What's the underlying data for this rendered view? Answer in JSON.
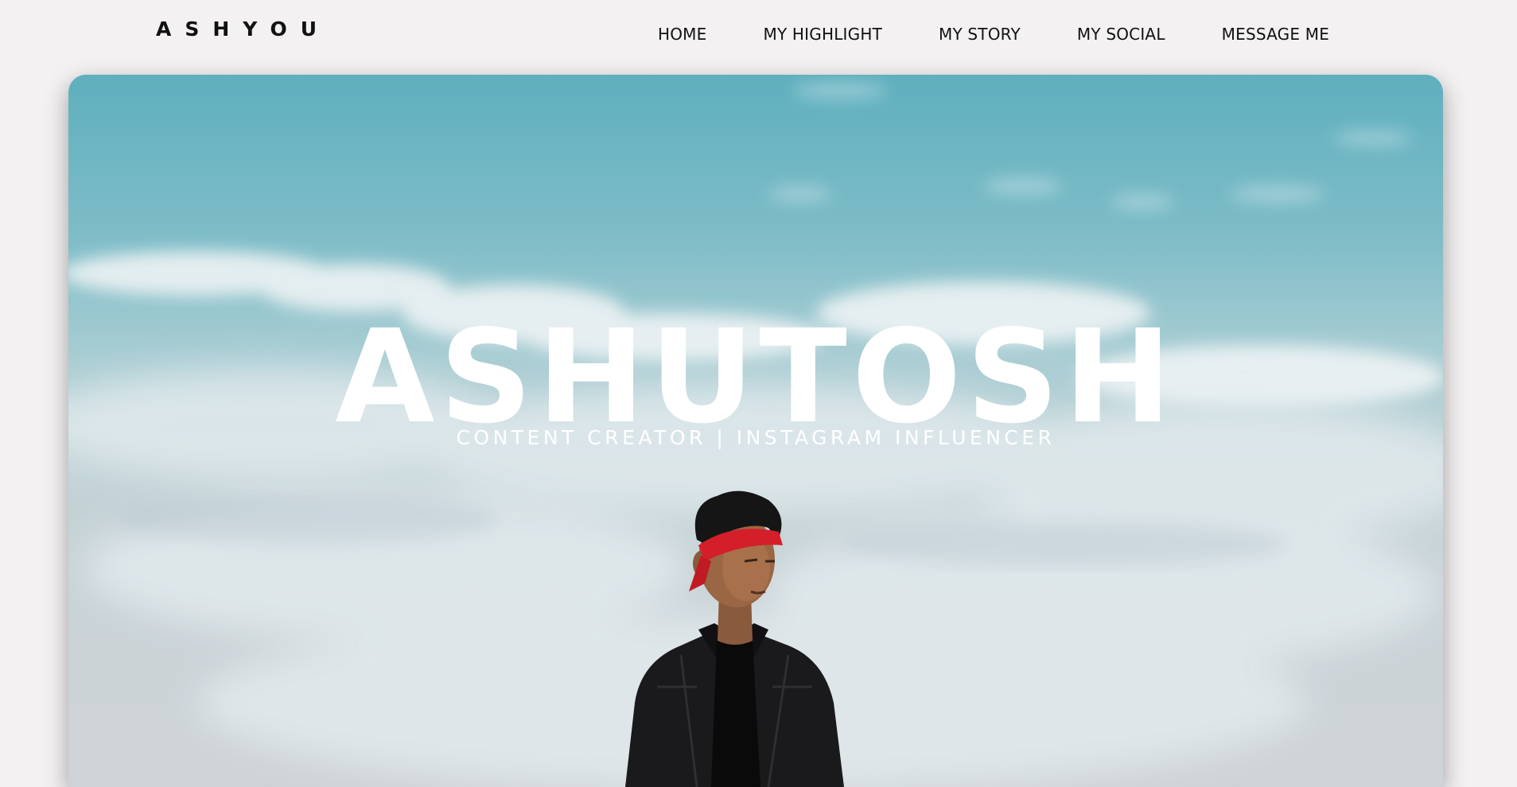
{
  "brand": {
    "logo": "ASHYOU"
  },
  "nav": {
    "items": [
      {
        "label": "HOME"
      },
      {
        "label": "MY HIGHLIGHT"
      },
      {
        "label": "MY STORY"
      },
      {
        "label": "MY SOCIAL"
      },
      {
        "label": "MESSAGE ME"
      }
    ]
  },
  "hero": {
    "title": "ASHUTOSH",
    "subtitle": "CONTENT CREATOR | INSTAGRAM INFLUENCER"
  },
  "colors": {
    "page_bg": "#f3f1f1",
    "sky_top": "#5fafbe",
    "sky_bottom": "#cfd3d7",
    "headband": "#d41f2b",
    "text_light": "#ffffff",
    "text_dark": "#111111"
  }
}
